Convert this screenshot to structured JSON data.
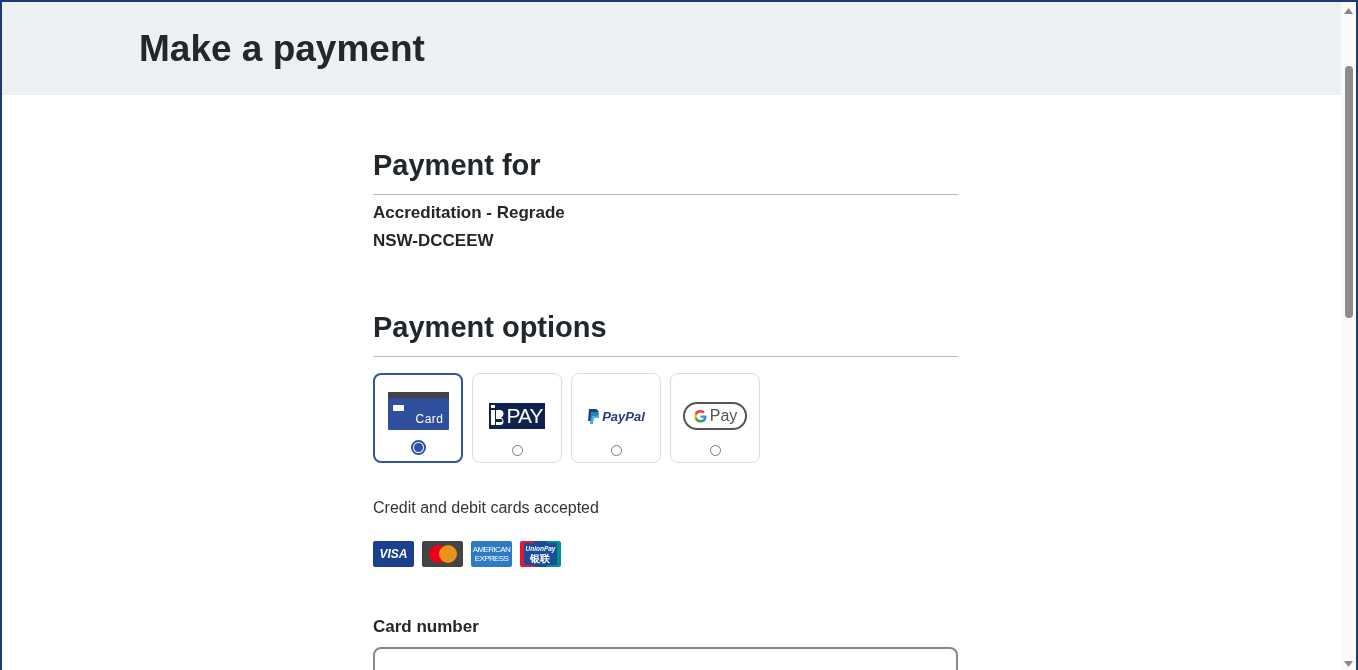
{
  "header": {
    "title": "Make a payment"
  },
  "payment_for": {
    "heading": "Payment for",
    "lines": [
      "Accreditation - Regrade",
      "NSW-DCCEEW"
    ]
  },
  "payment_options": {
    "heading": "Payment options",
    "options": [
      {
        "kind": "card",
        "texts": [
          "Card"
        ],
        "selected": true
      },
      {
        "kind": "bpay",
        "texts": [
          "PAY"
        ],
        "selected": false
      },
      {
        "kind": "paypal",
        "texts": [
          "PayPal"
        ],
        "selected": false
      },
      {
        "kind": "gpay",
        "texts": [
          "Pay"
        ],
        "selected": false
      }
    ]
  },
  "card_info": {
    "text": "Credit and debit cards accepted",
    "logos": [
      {
        "kind": "visa",
        "texts": [
          "VISA"
        ]
      },
      {
        "kind": "mastercard"
      },
      {
        "kind": "amex",
        "texts": [
          "AMERICAN",
          "EXPRESS"
        ]
      },
      {
        "kind": "unionpay",
        "texts": [
          "UnionPay",
          "银联"
        ]
      }
    ]
  },
  "card_number": {
    "label": "Card number"
  }
}
